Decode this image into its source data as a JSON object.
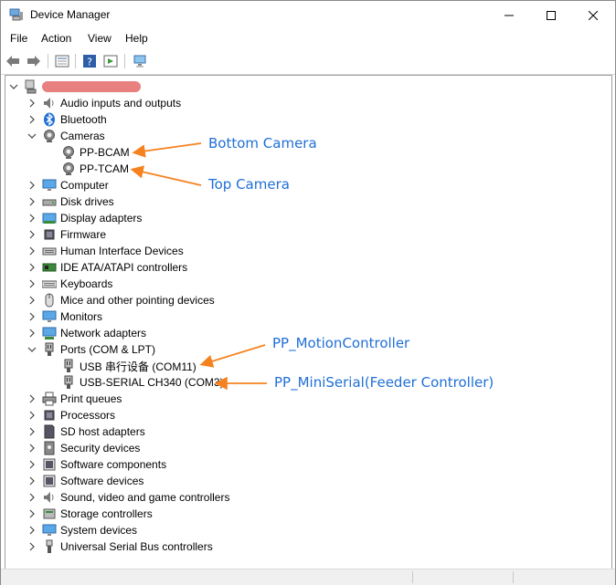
{
  "window": {
    "title": "Device Manager"
  },
  "menu": [
    "File",
    "Action",
    "View",
    "Help"
  ],
  "tree": [
    {
      "label": "",
      "level": 0,
      "expanded": true,
      "icon": "computer-root-icon",
      "redacted": true
    },
    {
      "label": "Audio inputs and outputs",
      "level": 1,
      "expanded": false,
      "icon": "speaker-icon"
    },
    {
      "label": "Bluetooth",
      "level": 1,
      "expanded": false,
      "icon": "bluetooth-icon"
    },
    {
      "label": "Cameras",
      "level": 1,
      "expanded": true,
      "icon": "camera-icon"
    },
    {
      "label": "PP-BCAM",
      "level": 2,
      "leaf": true,
      "icon": "camera-icon"
    },
    {
      "label": "PP-TCAM",
      "level": 2,
      "leaf": true,
      "icon": "camera-icon"
    },
    {
      "label": "Computer",
      "level": 1,
      "expanded": false,
      "icon": "monitor-icon"
    },
    {
      "label": "Disk drives",
      "level": 1,
      "expanded": false,
      "icon": "disk-icon"
    },
    {
      "label": "Display adapters",
      "level": 1,
      "expanded": false,
      "icon": "display-adapter-icon"
    },
    {
      "label": "Firmware",
      "level": 1,
      "expanded": false,
      "icon": "chip-icon"
    },
    {
      "label": "Human Interface Devices",
      "level": 1,
      "expanded": false,
      "icon": "hid-icon"
    },
    {
      "label": "IDE ATA/ATAPI controllers",
      "level": 1,
      "expanded": false,
      "icon": "controller-icon"
    },
    {
      "label": "Keyboards",
      "level": 1,
      "expanded": false,
      "icon": "keyboard-icon"
    },
    {
      "label": "Mice and other pointing devices",
      "level": 1,
      "expanded": false,
      "icon": "mouse-icon"
    },
    {
      "label": "Monitors",
      "level": 1,
      "expanded": false,
      "icon": "monitor-icon"
    },
    {
      "label": "Network adapters",
      "level": 1,
      "expanded": false,
      "icon": "network-icon"
    },
    {
      "label": "Ports (COM & LPT)",
      "level": 1,
      "expanded": true,
      "icon": "port-icon"
    },
    {
      "label": "USB 串行设备 (COM11)",
      "level": 2,
      "leaf": true,
      "icon": "port-icon"
    },
    {
      "label": "USB-SERIAL CH340 (COM3)",
      "level": 2,
      "leaf": true,
      "icon": "port-icon"
    },
    {
      "label": "Print queues",
      "level": 1,
      "expanded": false,
      "icon": "printer-icon"
    },
    {
      "label": "Processors",
      "level": 1,
      "expanded": false,
      "icon": "chip-icon"
    },
    {
      "label": "SD host adapters",
      "level": 1,
      "expanded": false,
      "icon": "sd-icon"
    },
    {
      "label": "Security devices",
      "level": 1,
      "expanded": false,
      "icon": "security-icon"
    },
    {
      "label": "Software components",
      "level": 1,
      "expanded": false,
      "icon": "software-icon"
    },
    {
      "label": "Software devices",
      "level": 1,
      "expanded": false,
      "icon": "software-icon"
    },
    {
      "label": "Sound, video and game controllers",
      "level": 1,
      "expanded": false,
      "icon": "speaker-icon"
    },
    {
      "label": "Storage controllers",
      "level": 1,
      "expanded": false,
      "icon": "storage-icon"
    },
    {
      "label": "System devices",
      "level": 1,
      "expanded": false,
      "icon": "monitor-icon"
    },
    {
      "label": "Universal Serial Bus controllers",
      "level": 1,
      "expanded": false,
      "icon": "usb-icon"
    }
  ],
  "annotations": [
    {
      "text": "Bottom Camera"
    },
    {
      "text": "Top Camera"
    },
    {
      "text": "PP_MotionController"
    },
    {
      "text": "PP_MiniSerial(Feeder Controller)"
    }
  ],
  "colors": {
    "annotation_text": "#1f6fd6",
    "annotation_arrow": "#f5821f"
  }
}
